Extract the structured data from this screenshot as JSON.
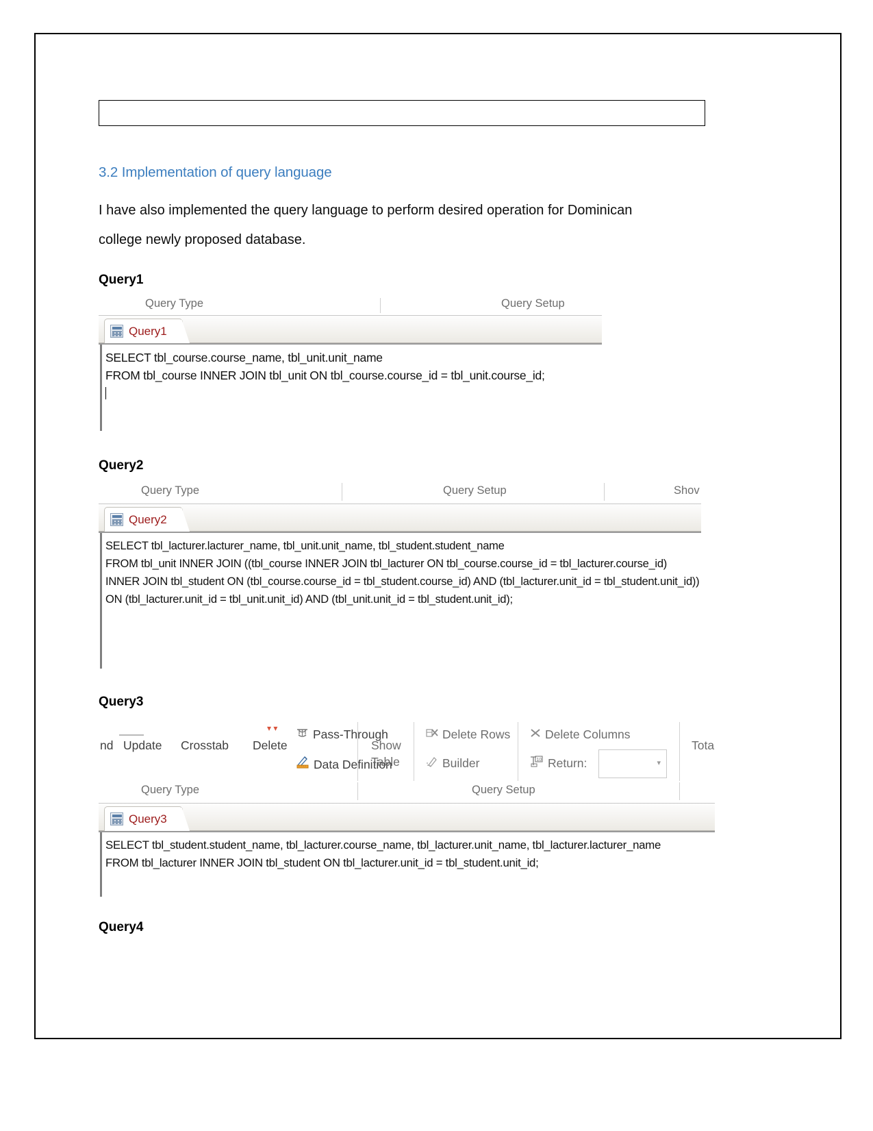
{
  "document": {
    "section_heading": "3.2 Implementation of query language",
    "paragraph_line1": "I have also implemented the query language to perform desired operation for Dominican",
    "paragraph_line2": "college newly proposed database.",
    "heading_color": "#3c7ebf"
  },
  "queries": [
    {
      "label": "Query1",
      "tab_title": "Query1",
      "group_labels": [
        "Query Type",
        "Query Setup"
      ],
      "sql_lines": [
        "SELECT tbl_course.course_name, tbl_unit.unit_name",
        "FROM tbl_course INNER JOIN tbl_unit ON tbl_course.course_id = tbl_unit.course_id;"
      ]
    },
    {
      "label": "Query2",
      "tab_title": "Query2",
      "group_labels": [
        "Query Type",
        "Query Setup",
        "Shov"
      ],
      "sql_lines": [
        "SELECT tbl_lacturer.lacturer_name, tbl_unit.unit_name, tbl_student.student_name",
        "FROM tbl_unit INNER JOIN ((tbl_course INNER JOIN tbl_lacturer ON tbl_course.course_id = tbl_lacturer.course_id)",
        "INNER JOIN tbl_student ON (tbl_course.course_id = tbl_student.course_id) AND (tbl_lacturer.unit_id = tbl_student.unit_id))",
        "ON (tbl_lacturer.unit_id = tbl_unit.unit_id) AND (tbl_unit.unit_id = tbl_student.unit_id);"
      ]
    },
    {
      "label": "Query3",
      "tab_title": "Query3",
      "group_labels": [
        "Query Type",
        "Query Setup"
      ],
      "ribbon": {
        "query_type_commands": [
          "nd",
          "Update",
          "Crosstab",
          "Delete"
        ],
        "pass_through_label": "Pass-Through",
        "data_definition_label": "Data Definition",
        "show_table_line1": "Show",
        "show_table_line2": "Table",
        "delete_rows_label": "Delete Rows",
        "delete_columns_label": "Delete Columns",
        "builder_label": "Builder",
        "return_label": "Return:",
        "return_value": "",
        "totals_label": "Totals"
      },
      "sql_lines": [
        "SELECT tbl_student.student_name, tbl_lacturer.course_name, tbl_lacturer.unit_name, tbl_lacturer.lacturer_name",
        "FROM tbl_lacturer INNER JOIN tbl_student ON tbl_lacturer.unit_id = tbl_student.unit_id;"
      ]
    },
    {
      "label": "Query4"
    }
  ]
}
